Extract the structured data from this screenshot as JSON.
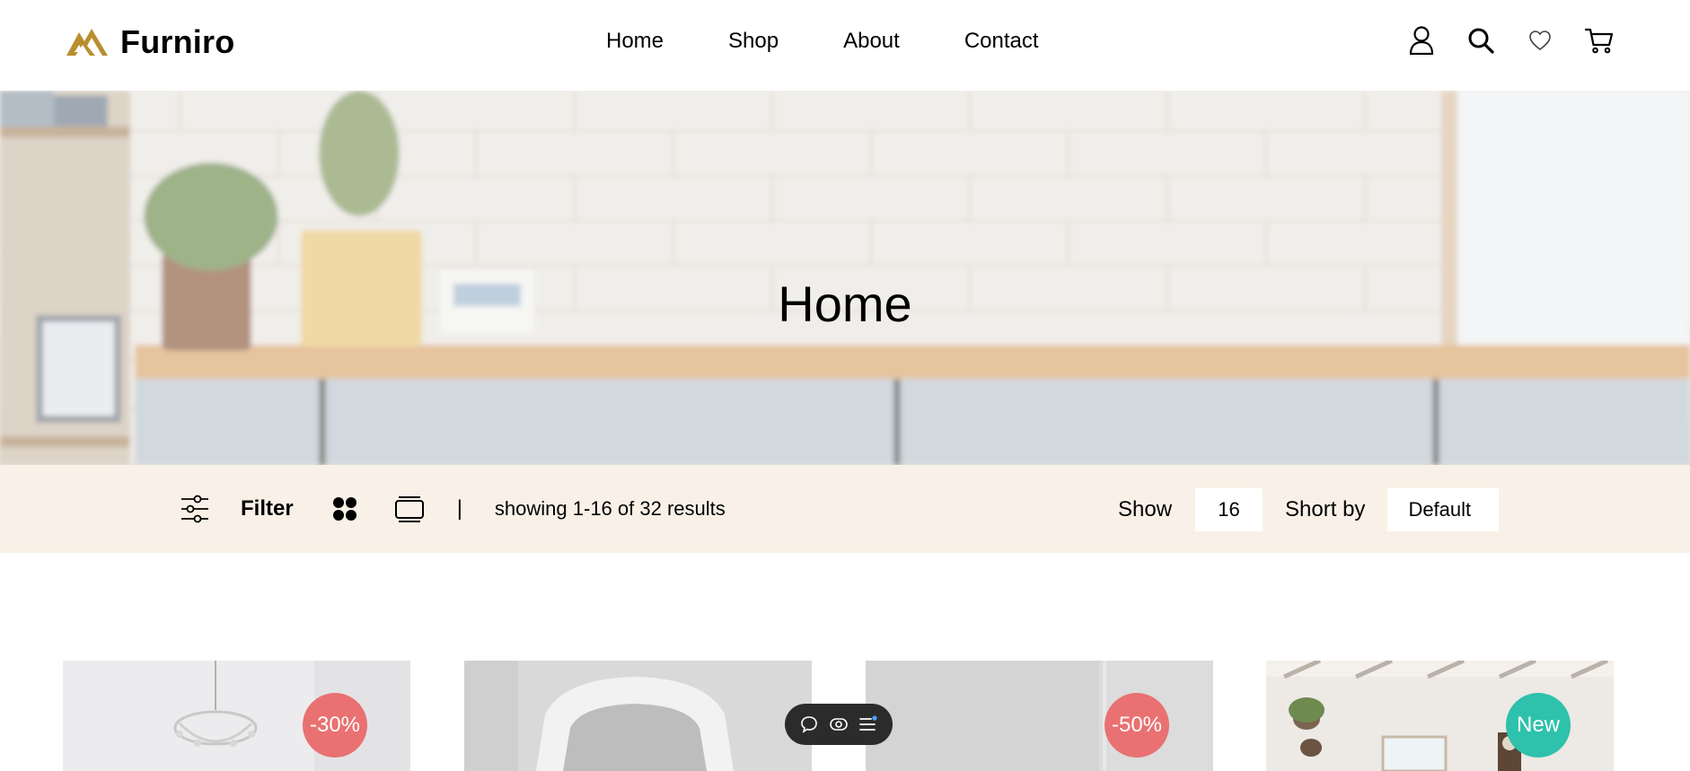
{
  "brand": {
    "name": "Furniro",
    "logo_color": "#b88e2f"
  },
  "nav": {
    "items": [
      "Home",
      "Shop",
      "About",
      "Contact"
    ]
  },
  "header_icons": [
    "user-icon",
    "search-icon",
    "heart-icon",
    "cart-icon"
  ],
  "hero": {
    "title": "Home"
  },
  "filter_bar": {
    "filter_label": "Filter",
    "divider": "|",
    "results_text": "showing 1-16 of 32 results",
    "show_label": "Show",
    "show_value": "16",
    "sort_label": "Short by",
    "sort_value": "Default",
    "background": "#f9f1e7"
  },
  "products": [
    {
      "badge": "-30%",
      "badge_type": "discount"
    },
    {
      "badge": "",
      "badge_type": "none"
    },
    {
      "badge": "-50%",
      "badge_type": "discount"
    },
    {
      "badge": "New",
      "badge_type": "new"
    }
  ],
  "colors": {
    "discount": "#e97171",
    "new": "#2ec1ac",
    "accent": "#b88e2f"
  },
  "floating_toolbar": {
    "icons": [
      "chat-icon",
      "eye-icon",
      "menu-icon"
    ]
  }
}
